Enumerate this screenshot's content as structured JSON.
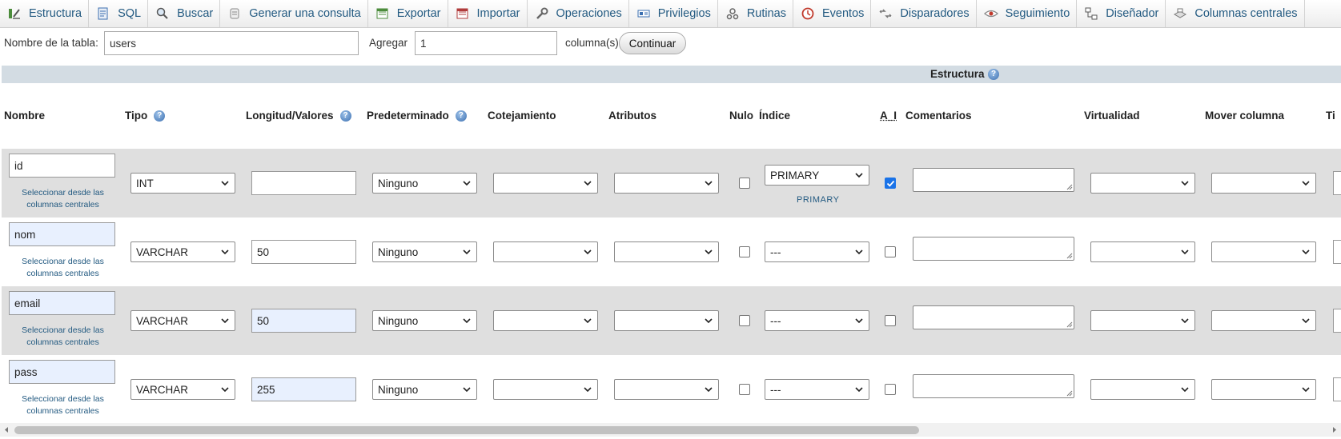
{
  "tabs": [
    {
      "label": "Estructura",
      "icon": "structure-icon"
    },
    {
      "label": "SQL",
      "icon": "sql-icon"
    },
    {
      "label": "Buscar",
      "icon": "search-icon"
    },
    {
      "label": "Generar una consulta",
      "icon": "query-icon"
    },
    {
      "label": "Exportar",
      "icon": "export-icon"
    },
    {
      "label": "Importar",
      "icon": "import-icon"
    },
    {
      "label": "Operaciones",
      "icon": "wrench-icon"
    },
    {
      "label": "Privilegios",
      "icon": "privileges-icon"
    },
    {
      "label": "Rutinas",
      "icon": "routines-icon"
    },
    {
      "label": "Eventos",
      "icon": "clock-icon"
    },
    {
      "label": "Disparadores",
      "icon": "triggers-icon"
    },
    {
      "label": "Seguimiento",
      "icon": "eye-icon"
    },
    {
      "label": "Diseñador",
      "icon": "designer-icon"
    },
    {
      "label": "Columnas centrales",
      "icon": "central-columns-icon"
    }
  ],
  "table_form": {
    "name_label": "Nombre de la tabla:",
    "name_value": "users",
    "add_label": "Agregar",
    "add_value": "1",
    "columns_suffix": "columna(s)",
    "continue_label": "Continuar"
  },
  "structure_title": "Estructura",
  "headers": {
    "nombre": "Nombre",
    "tipo": "Tipo",
    "longitud": "Longitud/Valores",
    "predeterminado": "Predeterminado",
    "cotejamiento": "Cotejamiento",
    "atributos": "Atributos",
    "nulo": "Nulo",
    "indice": "Índice",
    "ai": "A_I",
    "comentarios": "Comentarios",
    "virtualidad": "Virtualidad",
    "mover": "Mover columna",
    "next_partial": "Ti"
  },
  "central_link": "Seleccionar desde las columnas centrales",
  "rows": [
    {
      "name": "id",
      "type": "INT",
      "length": "",
      "default": "Ninguno",
      "collation": "",
      "attributes": "",
      "null": false,
      "index": "PRIMARY",
      "index_label": "PRIMARY",
      "ai": true,
      "comment": "",
      "virtuality": "",
      "move": ""
    },
    {
      "name": "nom",
      "type": "VARCHAR",
      "length": "50",
      "default": "Ninguno",
      "collation": "",
      "attributes": "",
      "null": false,
      "index": "---",
      "index_label": "",
      "ai": false,
      "comment": "",
      "virtuality": "",
      "move": ""
    },
    {
      "name": "email",
      "type": "VARCHAR",
      "length": "50",
      "default": "Ninguno",
      "collation": "",
      "attributes": "",
      "null": false,
      "index": "---",
      "index_label": "",
      "ai": false,
      "comment": "",
      "virtuality": "",
      "move": ""
    },
    {
      "name": "pass",
      "type": "VARCHAR",
      "length": "255",
      "default": "Ninguno",
      "collation": "",
      "attributes": "",
      "null": false,
      "index": "---",
      "index_label": "",
      "ai": false,
      "comment": "",
      "virtuality": "",
      "move": ""
    }
  ],
  "colors": {
    "link": "#235a81",
    "structure_header_bg": "#d3dce3",
    "row_odd_bg": "#dfdfdf",
    "checkbox_on": "#1a73e8"
  }
}
